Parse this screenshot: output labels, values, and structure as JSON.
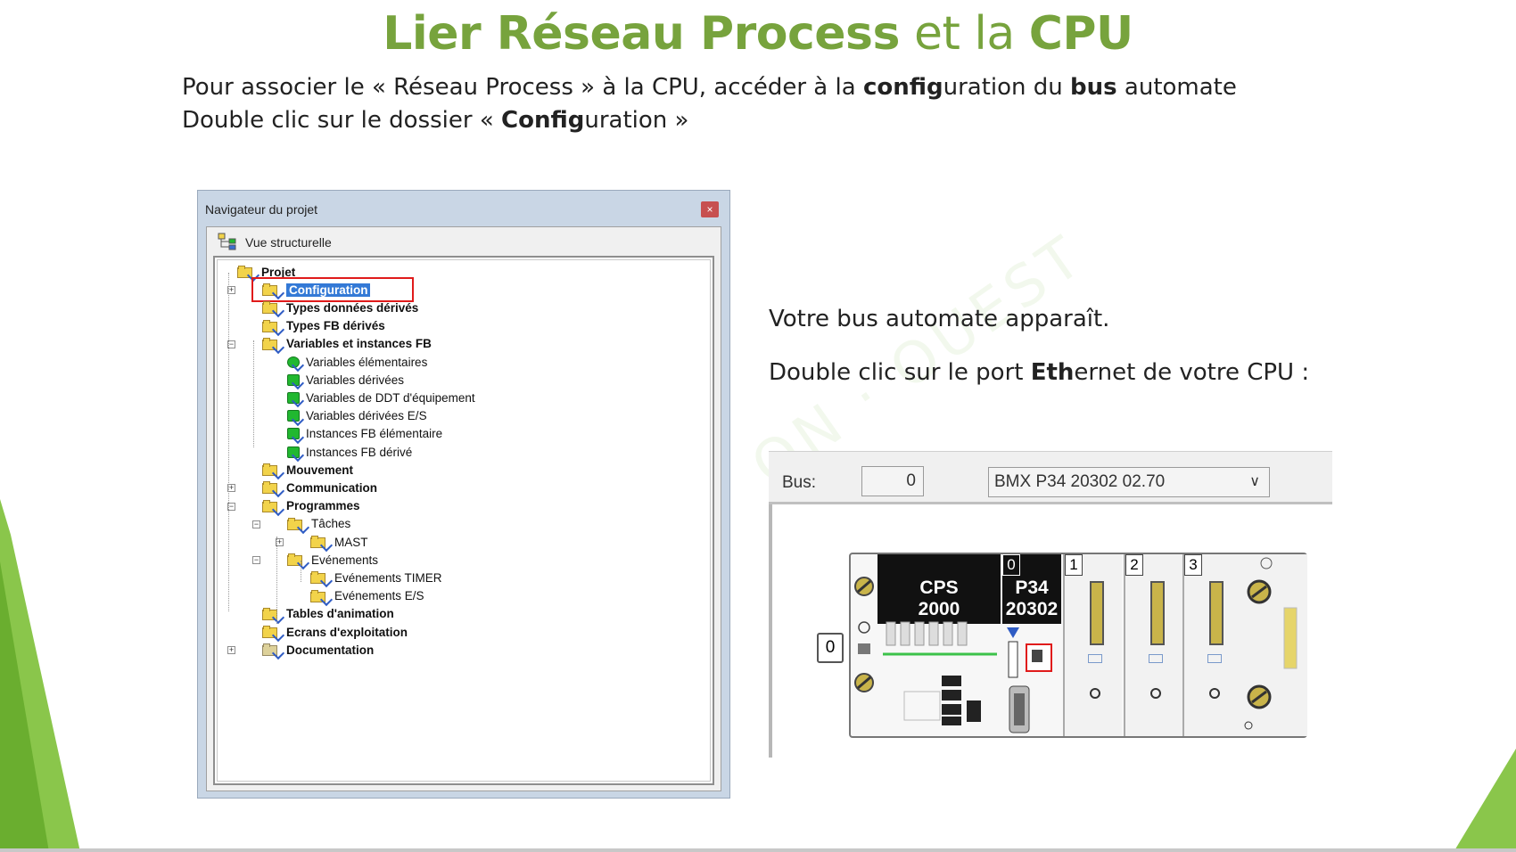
{
  "slide": {
    "title_part1": "Lier Réseau Process",
    "title_part2": " et la ",
    "title_part3": "CPU",
    "intro_line1": {
      "a": "Pour associer le « Réseau Process » à la CPU, accéder à la ",
      "b": "config",
      "c": "uration du ",
      "d": "bus",
      "e": " automate"
    },
    "intro_line2": {
      "a": "Double clic sur le dossier « ",
      "b": "Config",
      "c": "uration »"
    },
    "note1": "Votre bus automate apparaît.",
    "note2": {
      "a": "Double clic sur le port ",
      "b": "Eth",
      "c": "ernet de votre CPU :"
    },
    "accent_color": "#77a33d"
  },
  "navigator": {
    "title": "Navigateur du projet",
    "close_glyph": "×",
    "view_label": "Vue structurelle",
    "tree": [
      {
        "label": "Projet",
        "bold": true,
        "icon": "folder-open-icon"
      },
      {
        "label": "Configuration",
        "bold": true,
        "icon": "folder-icon",
        "selected": true
      },
      {
        "label": "Types données dérivés",
        "bold": true,
        "icon": "folder-icon"
      },
      {
        "label": "Types FB dérivés",
        "bold": true,
        "icon": "folder-icon"
      },
      {
        "label": "Variables et instances FB",
        "bold": true,
        "icon": "folder-open-icon"
      },
      {
        "label": "Variables élémentaires",
        "bold": false,
        "icon": "variable-icon"
      },
      {
        "label": "Variables dérivées",
        "bold": false,
        "icon": "variable-icon"
      },
      {
        "label": "Variables de DDT d'équipement",
        "bold": false,
        "icon": "variable-icon"
      },
      {
        "label": "Variables dérivées E/S",
        "bold": false,
        "icon": "variable-icon"
      },
      {
        "label": "Instances FB élémentaire",
        "bold": false,
        "icon": "fb-instance-icon"
      },
      {
        "label": "Instances FB dérivé",
        "bold": false,
        "icon": "fb-instance-icon"
      },
      {
        "label": "Mouvement",
        "bold": true,
        "icon": "folder-icon"
      },
      {
        "label": "Communication",
        "bold": true,
        "icon": "folder-icon"
      },
      {
        "label": "Programmes",
        "bold": true,
        "icon": "folder-open-icon"
      },
      {
        "label": "Tâches",
        "bold": false,
        "icon": "folder-open-icon"
      },
      {
        "label": "MAST",
        "bold": false,
        "icon": "folder-icon"
      },
      {
        "label": "Evénements",
        "bold": false,
        "icon": "folder-open-icon"
      },
      {
        "label": "Evénements TIMER",
        "bold": false,
        "icon": "folder-icon"
      },
      {
        "label": "Evénements E/S",
        "bold": false,
        "icon": "folder-icon"
      },
      {
        "label": "Tables d'animation",
        "bold": true,
        "icon": "folder-icon"
      },
      {
        "label": "Ecrans d'exploitation",
        "bold": true,
        "icon": "folder-icon"
      },
      {
        "label": "Documentation",
        "bold": true,
        "icon": "documentation-icon"
      }
    ]
  },
  "bus": {
    "label": "Bus:",
    "number": "0",
    "cpu_selected": "BMX P34 20302   02.70",
    "rack_number": "0",
    "ps_line1": "CPS",
    "ps_line2": "2000",
    "cpu_slot_number": "0",
    "cpu_line1": "P34",
    "cpu_line2": "20302",
    "slots": [
      "1",
      "2",
      "3"
    ]
  }
}
